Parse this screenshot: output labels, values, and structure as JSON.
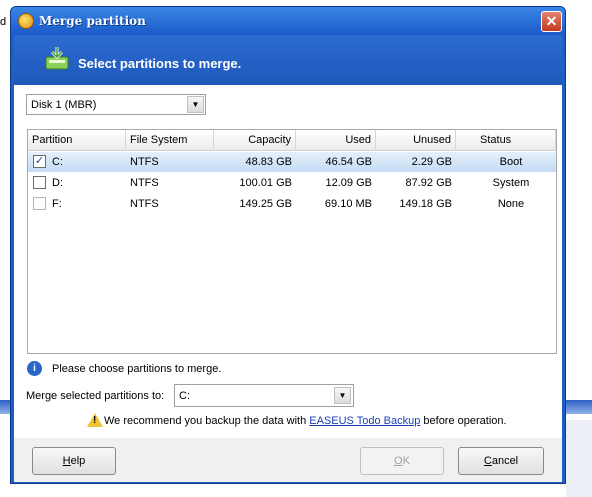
{
  "background": {
    "left_text": "d"
  },
  "window": {
    "title": "Merge partition",
    "close_glyph": "✕"
  },
  "header": {
    "text": "Select partitions to merge."
  },
  "disk_select": {
    "value": "Disk 1 (MBR)",
    "arrow": "▼"
  },
  "table": {
    "columns": [
      "Partition",
      "File System",
      "Capacity",
      "Used",
      "Unused",
      "Status"
    ],
    "rows": [
      {
        "partition": "C:",
        "fs": "NTFS",
        "capacity": "48.83 GB",
        "used": "46.54 GB",
        "unused": "2.29 GB",
        "status": "Boot",
        "checked": "✓"
      },
      {
        "partition": "D:",
        "fs": "NTFS",
        "capacity": "100.01 GB",
        "used": "12.09 GB",
        "unused": "87.92 GB",
        "status": "System",
        "checked": ""
      },
      {
        "partition": "F:",
        "fs": "NTFS",
        "capacity": "149.25 GB",
        "used": "69.10 MB",
        "unused": "149.18 GB",
        "status": "None",
        "checked": ""
      }
    ]
  },
  "info": {
    "icon": "i",
    "text": "Please choose partitions to merge."
  },
  "merge": {
    "label": "Merge selected partitions to:",
    "value": "C:",
    "arrow": "▼"
  },
  "warning": {
    "mark": "!",
    "before": "We recommend you backup the data with ",
    "link": "EASEUS Todo Backup",
    "after": " before operation."
  },
  "buttons": {
    "help_first": "H",
    "help_rest": "elp",
    "ok_first": "O",
    "ok_rest": "K",
    "cancel_first": "C",
    "cancel_rest": "ancel"
  },
  "colors": {
    "title_bar": "#1b5ac8",
    "link": "#1a3fb3"
  }
}
